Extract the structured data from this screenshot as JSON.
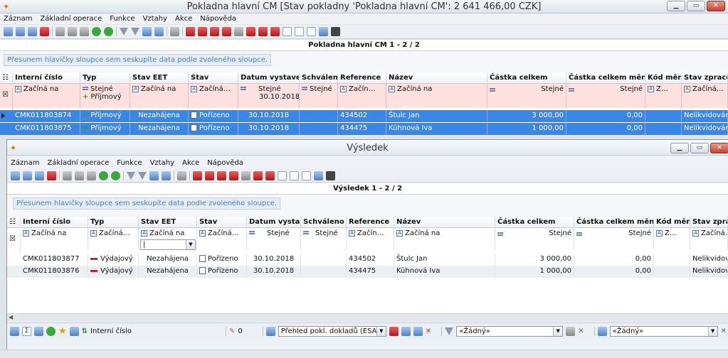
{
  "main": {
    "title": "Pokladna hlavní CM [Stav pokladny 'Pokladna hlavní CM': 2 641 466,00 CZK]",
    "menu": [
      "Záznam",
      "Základní operace",
      "Funkce",
      "Vztahy",
      "Akce",
      "Nápověda"
    ],
    "grid_title": "Pokladna hlavní CM  1 - 2 / 2",
    "group_hint": "Přesunem hlavičky sloupce sem seskupíte data podle zvoleného sloupce.",
    "columns": [
      "Interní číslo",
      "Typ",
      "Stav EET",
      "Stav",
      "Datum vystave",
      "Schváleno",
      "Reference",
      "Název",
      "Částka celkem",
      "Částka celkem měna",
      "Kód měny",
      "Stav zpracová"
    ],
    "filter": {
      "interni": "Začíná na",
      "typ": "Stejné",
      "typ_value": "Příjmový",
      "stav_eet": "Začíná na",
      "stav": "Začíná…",
      "datum": "Stejné",
      "datum_value": "30.10.2018",
      "schvaleno": "Stejné",
      "reference": "Začín…",
      "nazev": "Začíná na",
      "castka": "Stejné",
      "castka_mena": "Stejné",
      "kod_meny": "Z…",
      "stav_zprac": "Začíná…"
    },
    "rows": [
      {
        "interni": "CMK011803874",
        "typ": "Příjmový",
        "stav_eet": "Nezahájena",
        "stav": "Pořízeno",
        "datum": "30.10.2018",
        "reference": "434502",
        "nazev": "Štulc Jan",
        "castka": "3 000,00",
        "castka_mena": "0,00",
        "stav_zprac": "Nelikvidováno"
      },
      {
        "interni": "CMK011803875",
        "typ": "Příjmový",
        "stav_eet": "Nezahájena",
        "stav": "Pořízeno",
        "datum": "30.10.2018",
        "reference": "434475",
        "nazev": "Kühnová Iva",
        "castka": "1 000,00",
        "castka_mena": "0,00",
        "stav_zprac": "Nelikvidováno"
      }
    ]
  },
  "sub": {
    "title": "Výsledek",
    "menu": [
      "Záznam",
      "Základní operace",
      "Funkce",
      "Vztahy",
      "Akce",
      "Nápověda"
    ],
    "grid_title": "Výsledek  1 - 2 / 2",
    "group_hint": "Přesunem hlavičky sloupce sem seskupíte data podle zvoleného sloupce.",
    "columns": [
      "Interní číslo",
      "Typ",
      "Stav EET",
      "Stav",
      "Datum vystave",
      "Schváleno",
      "Reference",
      "Název",
      "Částka celkem",
      "Částka celkem měna",
      "Kód měny",
      "Stav zprac"
    ],
    "filter": {
      "interni": "Začíná na",
      "typ": "Začíná…",
      "stav_eet": "Začíná na",
      "stav": "Začíná…",
      "datum": "Stejné",
      "schvaleno": "Stejné",
      "reference": "Začín…",
      "nazev": "Začíná na",
      "castka": "Stejné",
      "castka_mena": "Stejné",
      "kod_meny": "Z…",
      "stav_zprac": "Začíná…"
    },
    "rows": [
      {
        "interni": "CMK011803877",
        "typ": "Výdajový",
        "stav_eet": "Nezahájena",
        "stav": "Pořízeno",
        "datum": "30.10.2018",
        "reference": "434502",
        "nazev": "Štulc Jan",
        "castka": "3 000,00",
        "castka_mena": "0,00",
        "stav_zprac": "Nelikvidová"
      },
      {
        "interni": "CMK011803876",
        "typ": "Výdajový",
        "stav_eet": "Nezahájena",
        "stav": "Pořízeno",
        "datum": "30.10.2018",
        "reference": "434475",
        "nazev": "Kühnová Iva",
        "castka": "1 000,00",
        "castka_mena": "0,00",
        "stav_zprac": "Nelikvidová"
      }
    ],
    "status": {
      "sort_label": "Interní číslo",
      "count": "0",
      "view_select": "Přehled pokl. dokladů (ESA)",
      "filter1": "«Žádný»",
      "filter2": "«Žádný»"
    }
  },
  "colors": {
    "selection": "#3a86e4",
    "filter_row": "#fde0e0",
    "hint_text": "#4a80c0"
  }
}
